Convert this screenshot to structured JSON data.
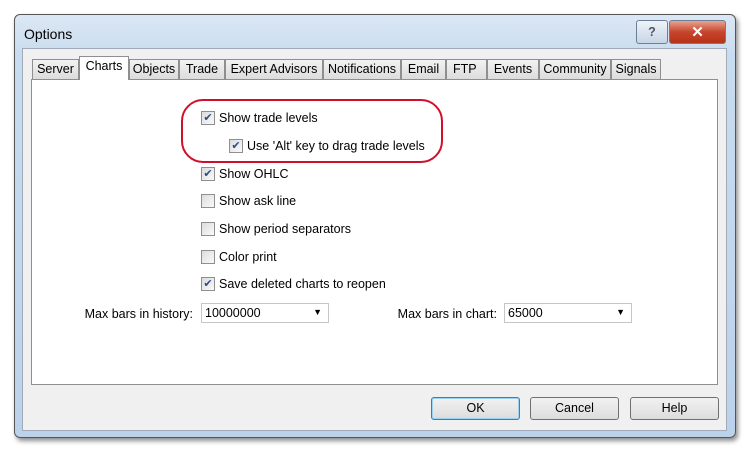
{
  "window": {
    "title": "Options"
  },
  "tabs": [
    "Server",
    "Charts",
    "Objects",
    "Trade",
    "Expert Advisors",
    "Notifications",
    "Email",
    "FTP",
    "Events",
    "Community",
    "Signals"
  ],
  "selected_tab": "Charts",
  "checkboxes": [
    {
      "label": "Show trade levels",
      "checked": true
    },
    {
      "label": "Use 'Alt' key to drag trade levels",
      "checked": true
    },
    {
      "label": "Show OHLC",
      "checked": true
    },
    {
      "label": "Show ask line",
      "checked": false
    },
    {
      "label": "Show period separators",
      "checked": false
    },
    {
      "label": "Color print",
      "checked": false
    },
    {
      "label": "Save deleted charts to reopen",
      "checked": true
    }
  ],
  "max_bars_history": {
    "label": "Max bars in history:",
    "value": "10000000"
  },
  "max_bars_chart": {
    "label": "Max bars in chart:",
    "value": "65000"
  },
  "buttons": {
    "ok": "OK",
    "cancel": "Cancel",
    "help": "Help"
  },
  "highlight_color": "#d0102a"
}
